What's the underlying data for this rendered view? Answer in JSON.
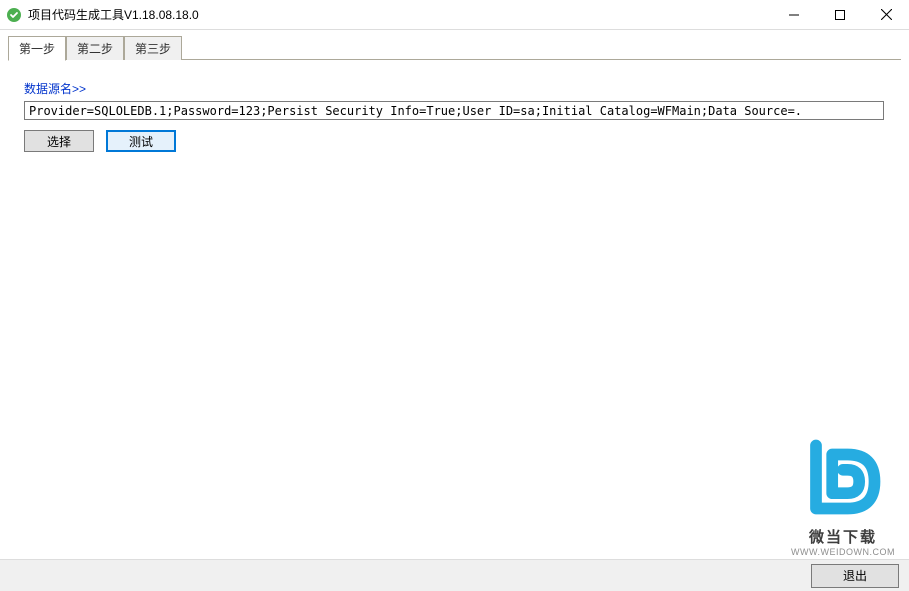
{
  "window": {
    "title": "项目代码生成工具V1.18.08.18.0"
  },
  "tabs": [
    {
      "label": "第一步",
      "active": true
    },
    {
      "label": "第二步",
      "active": false
    },
    {
      "label": "第三步",
      "active": false
    }
  ],
  "step1": {
    "label": "数据源名>>",
    "connection_string": "Provider=SQLOLEDB.1;Password=123;Persist Security Info=True;User ID=sa;Initial Catalog=WFMain;Data Source=.",
    "select_btn": "选择",
    "test_btn": "测试"
  },
  "bottom": {
    "exit_btn": "退出"
  },
  "watermark": {
    "text": "微当下载",
    "url": "WWW.WEIDOWN.COM"
  }
}
